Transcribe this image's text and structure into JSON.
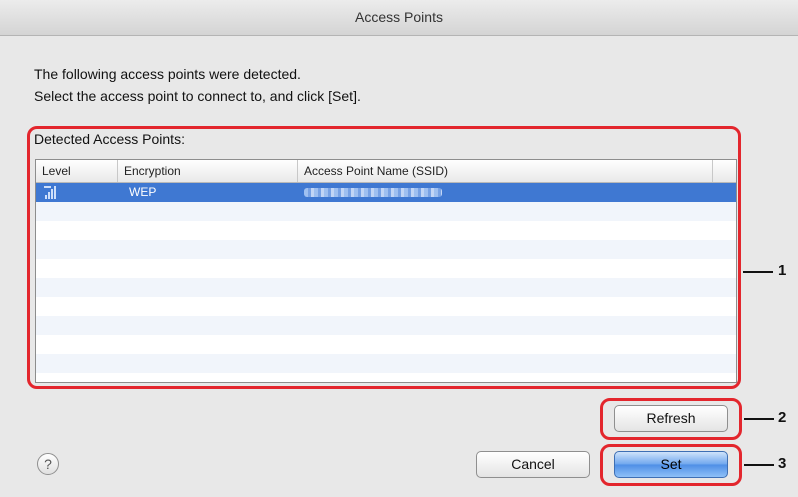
{
  "window": {
    "title": "Access Points"
  },
  "instructions": {
    "line1": "The following access points were detected.",
    "line2": "Select the access point to connect to, and click [Set]."
  },
  "group": {
    "label": "Detected Access Points:"
  },
  "table": {
    "columns": [
      "Level",
      "Encryption",
      "Access Point Name (SSID)"
    ],
    "rows": [
      {
        "level_icon": "signal-strength-icon",
        "encryption": "WEP",
        "ssid_obscured": true,
        "selected": true
      }
    ]
  },
  "buttons": {
    "refresh": "Refresh",
    "cancel": "Cancel",
    "set": "Set",
    "help": "?"
  },
  "annotations": {
    "n1": "1",
    "n2": "2",
    "n3": "3"
  },
  "colors": {
    "selection": "#3f78d2",
    "annotation": "#e3262d"
  }
}
